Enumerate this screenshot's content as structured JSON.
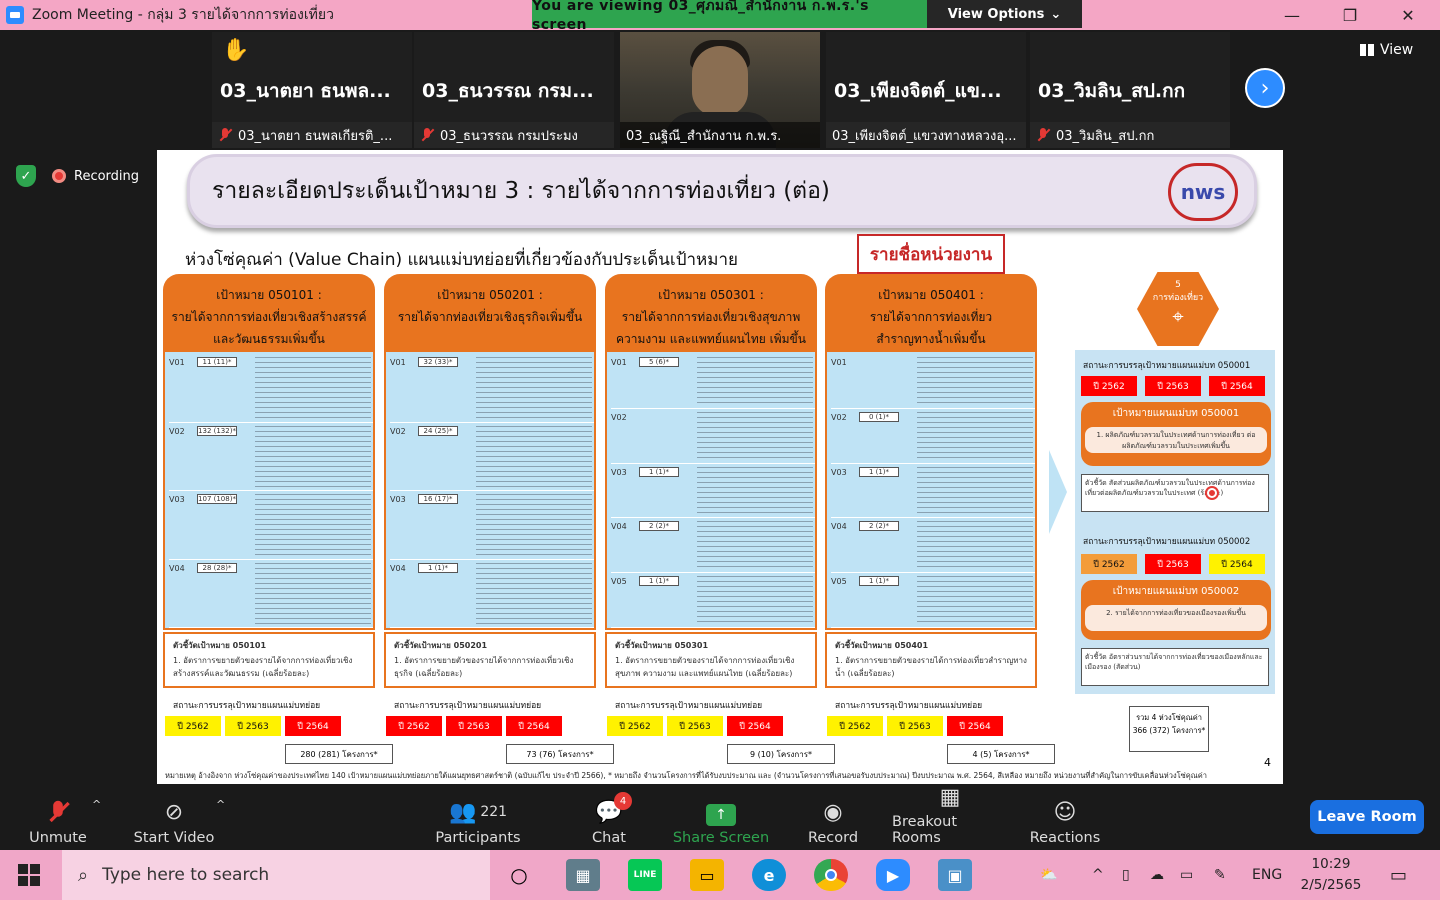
{
  "window": {
    "title": "Zoom Meeting - กลุ่ม 3 รายได้จากการท่องเที่ยว",
    "viewing_banner": "You are viewing 03_ศุภมณี_สำนักงาน ก.พ.ร.'s screen",
    "view_options": "View Options",
    "minimize_glyph": "—",
    "restore_glyph": "❐",
    "close_glyph": "✕",
    "app_icon": "zoom-icon"
  },
  "participants": [
    {
      "big_name": "03_นาตยา ธนพล...",
      "footer": "03_นาตยา ธนพลเกียรติ_...",
      "muted": true,
      "hand_raised": true
    },
    {
      "big_name": "03_ธนวรรณ กรม...",
      "footer": "03_ธนวรรณ กรมประมง",
      "muted": true,
      "hand_raised": false
    },
    {
      "big_name": "",
      "footer": "03_ณฐิณี_สำนักงาน ก.พ.ร.",
      "muted": false,
      "hand_raised": false,
      "video": true
    },
    {
      "big_name": "03_เพียงจิตต์_แข...",
      "footer": "03_เพียงจิตต์_แขวงทางหลวงอุ...",
      "muted": false,
      "hand_raised": false
    },
    {
      "big_name": "03_วิมลิน_สป.กก",
      "footer": "03_วิมลิน_สป.กก",
      "muted": true,
      "hand_raised": false
    }
  ],
  "strip": {
    "next_glyph": "›",
    "view_label": "View"
  },
  "status": {
    "security_icon": "shield-check-icon",
    "security_glyph": "✓",
    "recording_label": "Recording"
  },
  "slide": {
    "title": "รายละเอียดประเด็นเป้าหมาย 3 : รายได้จากการท่องเที่ยว (ต่อ)",
    "logo_text": "nws",
    "subhead": "ห่วงโซ่คุณค่า (Value Chain) แผนแม่บทย่อยที่เกี่ยวข้องกับประเด็นเป้าหมาย",
    "units_box": "รายชื่อหน่วยงาน",
    "columns": [
      {
        "code": "เป้าหมาย 050101 :",
        "line1": "รายได้จากการท่องเที่ยวเชิงสร้างสรรค์",
        "line2": "และวัฒนธรรมเพิ่มขึ้น",
        "rows": [
          {
            "code": "V01",
            "box": "11 (11)*"
          },
          {
            "code": "V02",
            "box": "132 (132)*"
          },
          {
            "code": "V03",
            "box": "107 (108)*"
          },
          {
            "code": "V04",
            "box": "28 (28)*"
          }
        ],
        "indicator_title": "ตัวชี้วัดเป้าหมาย 050101",
        "indicator_text": "1. อัตราการขยายตัวของรายได้จากการท่องเที่ยวเชิงสร้างสรรค์และวัฒนธรรม (เฉลี่ยร้อยละ)",
        "status_label": "สถานะการบรรลุเป้าหมายแผนแม่บทย่อย",
        "years": [
          {
            "label": "ปี 2562",
            "color": "yellow"
          },
          {
            "label": "ปี 2563",
            "color": "yellow"
          },
          {
            "label": "ปี 2564",
            "color": "red"
          }
        ],
        "projects": "280 (281) โครงการ*"
      },
      {
        "code": "เป้าหมาย 050201 :",
        "line1": "รายได้จากท่องเที่ยวเชิงธุรกิจเพิ่มขึ้น",
        "line2": "",
        "rows": [
          {
            "code": "V01",
            "box": "32 (33)*"
          },
          {
            "code": "V02",
            "box": "24 (25)*"
          },
          {
            "code": "V03",
            "box": "16 (17)*"
          },
          {
            "code": "V04",
            "box": "1 (1)*"
          }
        ],
        "indicator_title": "ตัวชี้วัดเป้าหมาย 050201",
        "indicator_text": "1. อัตราการขยายตัวของรายได้จากการท่องเที่ยวเชิงธุรกิจ (เฉลี่ยร้อยละ)",
        "status_label": "สถานะการบรรลุเป้าหมายแผนแม่บทย่อย",
        "years": [
          {
            "label": "ปี 2562",
            "color": "red"
          },
          {
            "label": "ปี 2563",
            "color": "red"
          },
          {
            "label": "ปี 2564",
            "color": "red"
          }
        ],
        "projects": "73 (76) โครงการ*"
      },
      {
        "code": "เป้าหมาย 050301 :",
        "line1": "รายได้จากการท่องเที่ยวเชิงสุขภาพ",
        "line2": "ความงาม และแพทย์แผนไทย เพิ่มขึ้น",
        "rows": [
          {
            "code": "V01",
            "box": "5 (6)*"
          },
          {
            "code": "V02",
            "box": ""
          },
          {
            "code": "V03",
            "box": "1 (1)*"
          },
          {
            "code": "V04",
            "box": "2 (2)*"
          },
          {
            "code": "V05",
            "box": "1 (1)*"
          }
        ],
        "indicator_title": "ตัวชี้วัดเป้าหมาย 050301",
        "indicator_text": "1. อัตราการขยายตัวของรายได้จากการท่องเที่ยวเชิงสุขภาพ ความงาม และแพทย์แผนไทย (เฉลี่ยร้อยละ)",
        "status_label": "สถานะการบรรลุเป้าหมายแผนแม่บทย่อย",
        "years": [
          {
            "label": "ปี 2562",
            "color": "yellow"
          },
          {
            "label": "ปี 2563",
            "color": "yellow"
          },
          {
            "label": "ปี 2564",
            "color": "red"
          }
        ],
        "projects": "9 (10) โครงการ*"
      },
      {
        "code": "เป้าหมาย 050401 :",
        "line1": "รายได้จากการท่องเที่ยว",
        "line2": "สำราญทางน้ำเพิ่มขึ้น",
        "rows": [
          {
            "code": "V01",
            "box": ""
          },
          {
            "code": "V02",
            "box": "0 (1)*"
          },
          {
            "code": "V03",
            "box": "1 (1)*"
          },
          {
            "code": "V04",
            "box": "2 (2)*"
          },
          {
            "code": "V05",
            "box": "1 (1)*"
          }
        ],
        "indicator_title": "ตัวชี้วัดเป้าหมาย 050401",
        "indicator_text": "1. อัตราการขยายตัวของรายได้การท่องเที่ยวสำราญทางน้ำ (เฉลี่ยร้อยละ)",
        "status_label": "สถานะการบรรลุเป้าหมายแผนแม่บทย่อย",
        "years": [
          {
            "label": "ปี 2562",
            "color": "yellow"
          },
          {
            "label": "ปี 2563",
            "color": "yellow"
          },
          {
            "label": "ปี 2564",
            "color": "red"
          }
        ],
        "projects": "4 (5) โครงการ*"
      }
    ],
    "right_panel": {
      "hex_top": "5",
      "hex_label": "การท่องเที่ยว",
      "status1": "สถานะการบรรลุเป้าหมายแผนแม่บท 050001",
      "years1": [
        {
          "label": "ปี 2562",
          "color": "red"
        },
        {
          "label": "ปี 2563",
          "color": "red"
        },
        {
          "label": "ปี 2564",
          "color": "red"
        }
      ],
      "goal1_title": "เป้าหมายแผนแม่บท 050001",
      "goal1_text": "1. ผลิตภัณฑ์มวลรวมในประเทศด้านการท่องเที่ยว ต่อผลิตภัณฑ์มวลรวมในประเทศเพิ่มขึ้น",
      "ind1_text": "ตัวชี้วัด สัดส่วนผลิตภัณฑ์มวลรวมในประเทศด้านการท่องเที่ยวต่อผลิตภัณฑ์มวลรวมในประเทศ (ร้อยละ)",
      "status2": "สถานะการบรรลุเป้าหมายแผนแม่บท 050002",
      "years2": [
        {
          "label": "ปี 2562",
          "color": "orange"
        },
        {
          "label": "ปี 2563",
          "color": "red"
        },
        {
          "label": "ปี 2564",
          "color": "yellow"
        }
      ],
      "goal2_title": "เป้าหมายแผนแม่บท 050002",
      "goal2_text": "2. รายได้จากการท่องเที่ยวของเมืองรองเพิ่มขึ้น",
      "ind2_text": "ตัวชี้วัด อัตราส่วนรายได้จากการท่องเที่ยวของเมืองหลักและเมืองรอง (สัดส่วน)",
      "total": "รวม 4 ห่วงโซ่คุณค่า 366 (372) โครงการ*"
    },
    "footnote": "หมายเหตุ อ้างอิงจาก ห่วงโซ่คุณค่าของประเทศไทย 140 เป้าหมายแผนแม่บทย่อยภายใต้แผนยุทธศาสตร์ชาติ (ฉบับแก้ไข ประจำปี 2566), * หมายถึง จำนวนโครงการที่ได้รับงบประมาณ และ (จำนวนโครงการที่เสนอขอรับงบประมาณ) ปีงบประมาณ พ.ศ. 2564, สีเหลือง หมายถึง หน่วยงานที่สำคัญในการขับเคลื่อนห่วงโซ่คุณค่า",
    "page": "4"
  },
  "toolbar": {
    "unmute": "Unmute",
    "start_video": "Start Video",
    "participants": "Participants",
    "participants_count": "221",
    "chat": "Chat",
    "chat_badge": "4",
    "share": "Share Screen",
    "record": "Record",
    "breakout": "Breakout Rooms",
    "reactions": "Reactions",
    "leave": "Leave Room"
  },
  "taskbar": {
    "search_placeholder": "Type here to search",
    "lang": "ENG",
    "time": "10:29",
    "date": "2/5/2565",
    "apps": [
      "cortana-icon",
      "calculator-icon",
      "line-icon",
      "file-explorer-icon",
      "edge-icon",
      "chrome-icon",
      "zoom-icon",
      "photos-icon"
    ],
    "line_label": "LINE"
  },
  "colors": {
    "accent_green": "#2ea44f",
    "zoom_blue": "#2d8cff",
    "slide_orange": "#e8741f",
    "titlebar_pink": "#f4a6c5"
  }
}
